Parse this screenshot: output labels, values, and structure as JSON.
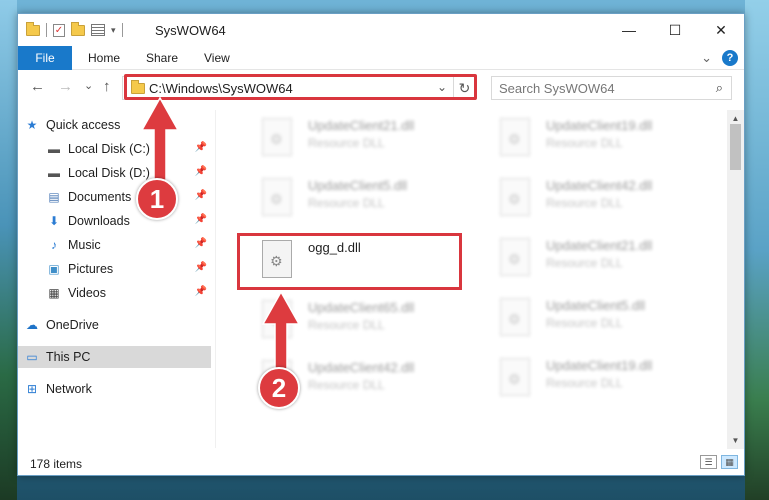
{
  "window": {
    "title": "SysWOW64"
  },
  "window_controls": {
    "minimize": "—",
    "maximize": "☐",
    "close": "✕"
  },
  "ribbon": {
    "tabs": [
      "File",
      "Home",
      "Share",
      "View"
    ],
    "expand_glyph": "⌄",
    "help_glyph": "?"
  },
  "nav": {
    "back_glyph": "←",
    "forward_glyph": "→",
    "recent_glyph": "⌄",
    "up_glyph": "↑",
    "address": "C:\\Windows\\SysWOW64",
    "address_dropdown_glyph": "⌄",
    "refresh_glyph": "↻",
    "search_placeholder": "Search SysWOW64",
    "search_glyph": "⌕"
  },
  "sidebar": {
    "items": [
      {
        "label": "Quick access",
        "icon": "star-icon",
        "glyph": "★",
        "color": "#2b7cd3",
        "pinned": false
      },
      {
        "label": "Local Disk (C:)",
        "icon": "drive-icon",
        "glyph": "▬",
        "color": "#555555",
        "pinned": true
      },
      {
        "label": "Local Disk (D:)",
        "icon": "drive-icon",
        "glyph": "▬",
        "color": "#555555",
        "pinned": true
      },
      {
        "label": "Documents",
        "icon": "documents-icon",
        "glyph": "▤",
        "color": "#4a78b5",
        "pinned": true
      },
      {
        "label": "Downloads",
        "icon": "download-icon",
        "glyph": "⬇",
        "color": "#2b7cd3",
        "pinned": true
      },
      {
        "label": "Music",
        "icon": "music-icon",
        "glyph": "♪",
        "color": "#2b7cd3",
        "pinned": true
      },
      {
        "label": "Pictures",
        "icon": "pictures-icon",
        "glyph": "▣",
        "color": "#3f8fc9",
        "pinned": true
      },
      {
        "label": "Videos",
        "icon": "videos-icon",
        "glyph": "▦",
        "color": "#444444",
        "pinned": true
      },
      {
        "label": "OneDrive",
        "icon": "cloud-icon",
        "glyph": "☁",
        "color": "#1e73c8",
        "pinned": false
      },
      {
        "label": "This PC",
        "icon": "computer-icon",
        "glyph": "▭",
        "color": "#2b7cd3",
        "pinned": false,
        "selected": true
      },
      {
        "label": "Network",
        "icon": "network-icon",
        "glyph": "⊞",
        "color": "#2b7cd3",
        "pinned": false
      }
    ],
    "pin_glyph": "📌"
  },
  "files": {
    "left_column": [
      {
        "name": "UpdateClient21.dll",
        "desc": "Resource DLL",
        "blurred": true
      },
      {
        "name": "UpdateClient5.dll",
        "desc": "Resource DLL",
        "blurred": true
      },
      {
        "name": "ogg_d.dll",
        "desc": "",
        "blurred": false
      },
      {
        "name": "UpdateClient65.dll",
        "desc": "Resource DLL",
        "blurred": true
      },
      {
        "name": "UpdateClient42.dll",
        "desc": "Resource DLL",
        "blurred": true
      }
    ],
    "right_column": [
      {
        "name": "UpdateClient19.dll",
        "desc": "Resource DLL",
        "blurred": true
      },
      {
        "name": "UpdateClient42.dll",
        "desc": "Resource DLL",
        "blurred": true
      },
      {
        "name": "UpdateClient21.dll",
        "desc": "Resource DLL",
        "blurred": true
      },
      {
        "name": "UpdateClient5.dll",
        "desc": "Resource DLL",
        "blurred": true
      },
      {
        "name": "UpdateClient19.dll",
        "desc": "Resource DLL",
        "blurred": true
      }
    ]
  },
  "status": {
    "item_count": "178 items"
  },
  "annotations": {
    "step1": "1",
    "step2": "2",
    "accent": "#dd3b3f"
  }
}
